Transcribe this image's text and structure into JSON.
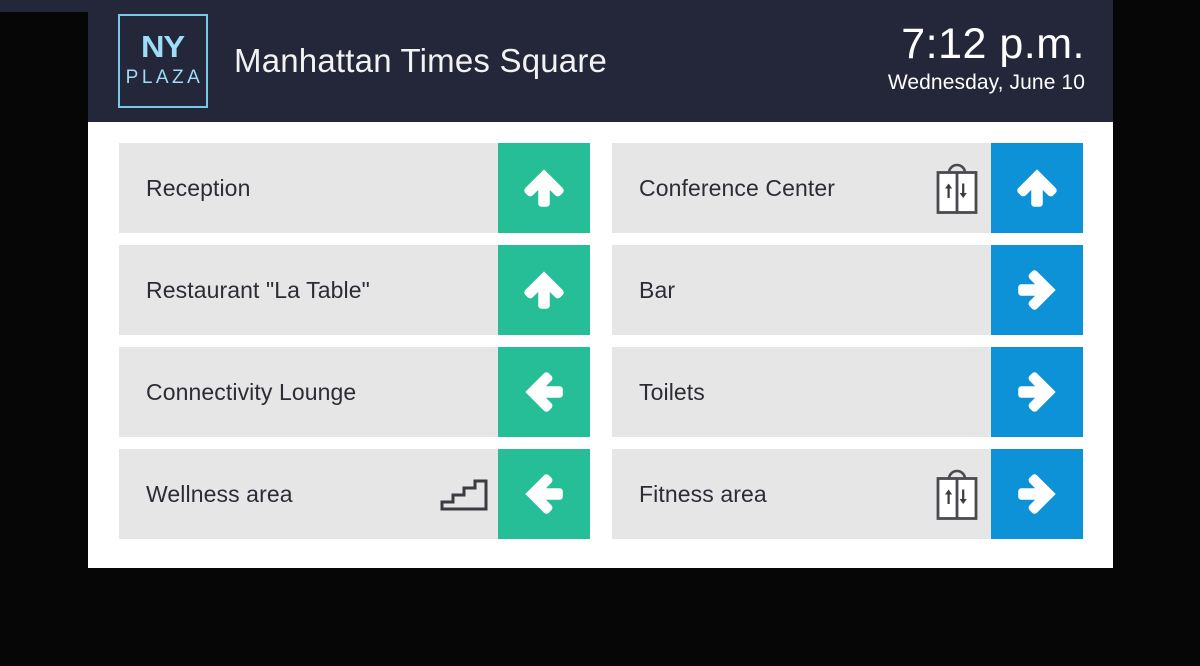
{
  "header": {
    "logo": {
      "line1": "NY",
      "line2": "PLAZA"
    },
    "venue_title": "Manhattan Times Square",
    "clock": {
      "time": "7:12 p.m.",
      "date": "Wednesday, June 10"
    },
    "background_color": "#24263a",
    "logo_color": "#9fdcf5"
  },
  "colors": {
    "green_arrow": "#26be97",
    "blue_arrow": "#0d92d8",
    "row_background": "#e6e6e6",
    "panel_background": "#ffffff",
    "label_text": "#2c2c36"
  },
  "board": {
    "left_column": [
      {
        "label": "Reception",
        "access_icon": "",
        "arrow": "up",
        "arrow_color": "green"
      },
      {
        "label": "Restaurant \"La Table\"",
        "access_icon": "",
        "arrow": "up",
        "arrow_color": "green"
      },
      {
        "label": "Connectivity Lounge",
        "access_icon": "",
        "arrow": "left",
        "arrow_color": "green"
      },
      {
        "label": "Wellness area",
        "access_icon": "stairs-icon",
        "arrow": "left",
        "arrow_color": "green"
      }
    ],
    "right_column": [
      {
        "label": "Conference Center",
        "access_icon": "elevator-icon",
        "arrow": "up",
        "arrow_color": "blue"
      },
      {
        "label": "Bar",
        "access_icon": "",
        "arrow": "right",
        "arrow_color": "blue"
      },
      {
        "label": "Toilets",
        "access_icon": "",
        "arrow": "right",
        "arrow_color": "blue"
      },
      {
        "label": "Fitness area",
        "access_icon": "elevator-icon",
        "arrow": "right",
        "arrow_color": "blue"
      }
    ]
  }
}
